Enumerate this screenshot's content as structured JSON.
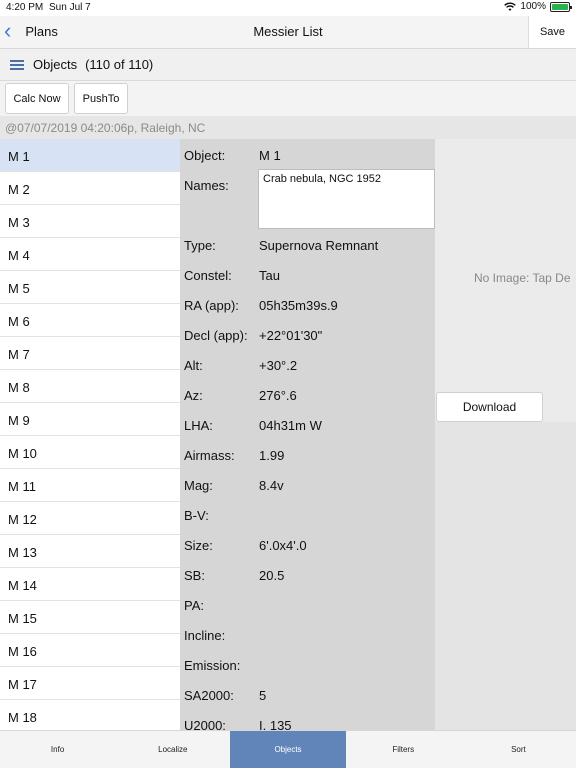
{
  "status_bar": {
    "time": "4:20 PM",
    "date": "Sun Jul 7",
    "battery": "100%"
  },
  "nav": {
    "back_label": "Plans",
    "title": "Messier List",
    "save_label": "Save"
  },
  "objects_bar": {
    "label": "Objects",
    "count": "(110 of 110)"
  },
  "toolbar": {
    "calc_now": "Calc Now",
    "push_to": "PushTo"
  },
  "info_line": "@07/07/2019 04:20:06p, Raleigh, NC",
  "object_list": [
    "M 1",
    "M 2",
    "M 3",
    "M 4",
    "M 5",
    "M 6",
    "M 7",
    "M 8",
    "M 9",
    "M 10",
    "M 11",
    "M 12",
    "M 13",
    "M 14",
    "M 15",
    "M 16",
    "M 17",
    "M 18"
  ],
  "selected_object": "M 1",
  "detail": {
    "object": {
      "label": "Object:",
      "value": "M 1"
    },
    "names": {
      "label": "Names:",
      "value": "Crab nebula, NGC 1952"
    },
    "type": {
      "label": "Type:",
      "value": "Supernova Remnant"
    },
    "constel": {
      "label": "Constel:",
      "value": "Tau"
    },
    "ra": {
      "label": "RA (app):",
      "value": "05h35m39s.9"
    },
    "decl": {
      "label": "Decl (app):",
      "value": "+22°01'30\""
    },
    "alt": {
      "label": "Alt:",
      "value": "+30°.2"
    },
    "az": {
      "label": "Az:",
      "value": "276°.6"
    },
    "lha": {
      "label": "LHA:",
      "value": "04h31m W"
    },
    "airmass": {
      "label": "Airmass:",
      "value": "1.99"
    },
    "mag": {
      "label": "Mag:",
      "value": "8.4v"
    },
    "bv": {
      "label": "B-V:",
      "value": ""
    },
    "size": {
      "label": "Size:",
      "value": "6'.0x4'.0"
    },
    "sb": {
      "label": "SB:",
      "value": "20.5"
    },
    "pa": {
      "label": "PA:",
      "value": ""
    },
    "incline": {
      "label": "Incline:",
      "value": ""
    },
    "emission": {
      "label": "Emission:",
      "value": ""
    },
    "sa2000": {
      "label": "SA2000:",
      "value": "5"
    },
    "u2000": {
      "label": "U2000:",
      "value": "I, 135"
    }
  },
  "image_panel": {
    "no_image": "No Image: Tap De",
    "download": "Download"
  },
  "tabs": [
    {
      "label": "Info"
    },
    {
      "label": "Localize"
    },
    {
      "label": "Objects"
    },
    {
      "label": "Filters"
    },
    {
      "label": "Sort"
    }
  ],
  "active_tab": "Objects",
  "colors": {
    "accent": "#6285b9",
    "selected_row": "#d7e3f4",
    "detail_bg": "#d6d6d6"
  }
}
